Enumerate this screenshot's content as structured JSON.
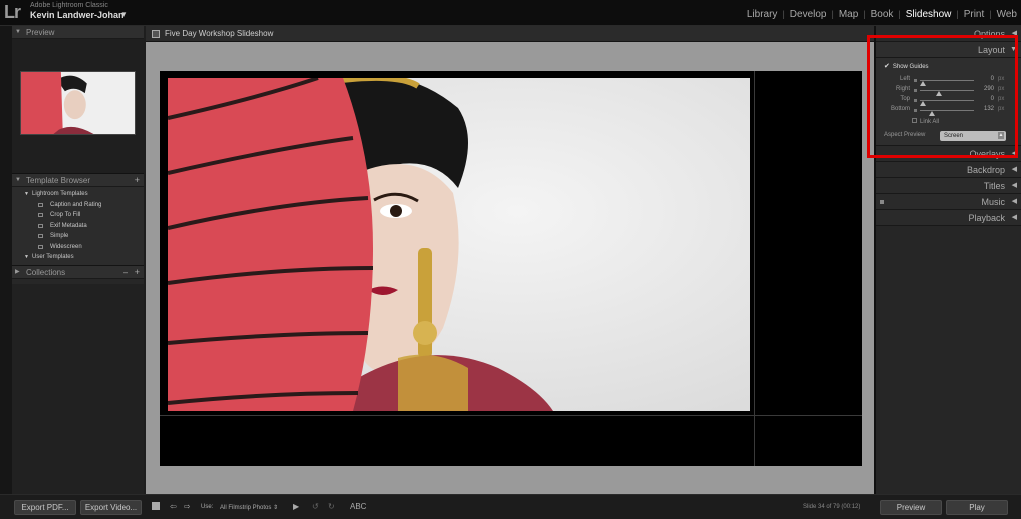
{
  "app": {
    "logo": "Lr",
    "product_name": "Adobe Lightroom Classic",
    "user_name": "Kevin Landwer-Johan",
    "user_caret": "▼"
  },
  "modules": [
    {
      "label": "Library",
      "active": false
    },
    {
      "label": "Develop",
      "active": false
    },
    {
      "label": "Map",
      "active": false
    },
    {
      "label": "Book",
      "active": false
    },
    {
      "label": "Slideshow",
      "active": true
    },
    {
      "label": "Print",
      "active": false
    },
    {
      "label": "Web",
      "active": false
    }
  ],
  "left_panel": {
    "preview_header": "Preview",
    "template_browser_header": "Template Browser",
    "lightroom_templates_folder": "Lightroom Templates",
    "templates": [
      "Caption and Rating",
      "Crop To Fill",
      "Exif Metadata",
      "Simple",
      "Widescreen"
    ],
    "user_templates_folder": "User Templates",
    "collections_header": "Collections"
  },
  "center": {
    "document_title": "Five Day Workshop Slideshow"
  },
  "right_panel": {
    "options_header": "Options",
    "layout_header": "Layout",
    "show_guides_label": "Show Guides",
    "show_guides_checked": true,
    "sliders": [
      {
        "label": "Left",
        "value": "0",
        "unit": "px",
        "pos": 0.05
      },
      {
        "label": "Right",
        "value": "290",
        "unit": "px",
        "pos": 0.35
      },
      {
        "label": "Top",
        "value": "0",
        "unit": "px",
        "pos": 0.05
      },
      {
        "label": "Bottom",
        "value": "132",
        "unit": "px",
        "pos": 0.22
      }
    ],
    "link_all_label": "Link All",
    "aspect_preview_label": "Aspect Preview",
    "aspect_preview_value": "Screen",
    "sections": [
      "Overlays",
      "Backdrop",
      "Titles",
      "Music",
      "Playback"
    ]
  },
  "bottom": {
    "export_pdf": "Export PDF...",
    "export_video": "Export Video...",
    "use_label": "Use:",
    "use_value": "All Filmstrip Photos",
    "text_tool": "ABC",
    "slide_count": "Slide 34 of 79 (00:12)",
    "preview_button": "Preview",
    "play_button": "Play"
  },
  "colors": {
    "highlight": "#e00000",
    "parasol": "#d94a55",
    "active_module": "#ffffff"
  }
}
